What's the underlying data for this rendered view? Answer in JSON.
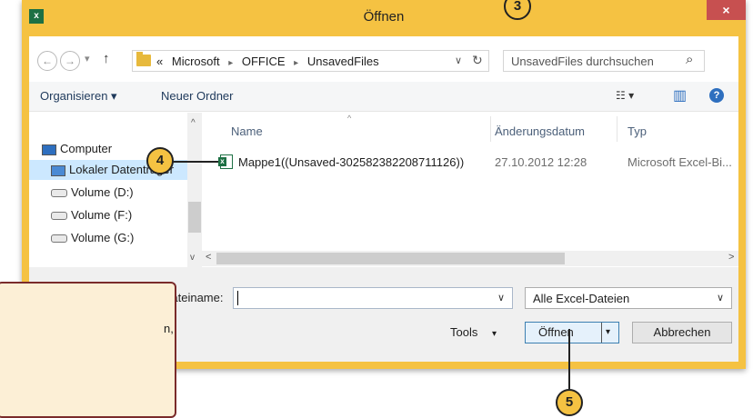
{
  "colors": {
    "frame": "#f5c242",
    "close_button": "#c75050",
    "excel_green": "#1d7044",
    "link_blue": "#1e395b",
    "selection": "#cce8ff",
    "callout_fill": "#f5c242",
    "note_fill": "#fcefd6",
    "note_border": "#7a2b2b"
  },
  "window": {
    "title": "Öffnen",
    "app_icon": "excel-icon",
    "close_glyph": "×"
  },
  "address_bar": {
    "back_glyph": "←",
    "forward_glyph": "→",
    "dropdown_glyph": "▾",
    "up_glyph": "↑",
    "overflow": "«",
    "crumbs": [
      "Microsoft",
      "OFFICE",
      "UnsavedFiles"
    ],
    "crumb_separator": "▸",
    "history_glyph": "∨",
    "refresh_glyph": "↻"
  },
  "search": {
    "placeholder": "UnsavedFiles durchsuchen",
    "icon_glyph": "⌕"
  },
  "toolbar": {
    "organize_label": "Organisieren ▾",
    "new_folder_label": "Neuer Ordner",
    "view_glyph": "☷ ▾",
    "preview_glyph": "▥",
    "help_glyph": "?"
  },
  "nav_pane": {
    "items": [
      {
        "label": "Computer",
        "icon": "computer-icon"
      },
      {
        "label": "Lokaler Datenträger",
        "icon": "drive-icon"
      },
      {
        "label": "Volume (D:)",
        "icon": "drive-icon"
      },
      {
        "label": "Volume (F:)",
        "icon": "drive-icon"
      },
      {
        "label": "Volume (G:)",
        "icon": "drive-icon"
      }
    ]
  },
  "file_list": {
    "columns": [
      "Name",
      "Änderungsdatum",
      "Typ"
    ],
    "sort_glyph": "^",
    "rows": [
      {
        "name": "Mappe1((Unsaved-302582382208711126))",
        "modified": "27.10.2012 12:28",
        "type": "Microsoft Excel-Bi..."
      }
    ]
  },
  "bottom": {
    "filename_label": "Dateiname:",
    "filename_value": "",
    "filetype_value": "Alle Excel-Dateien",
    "tools_label": "Tools",
    "open_label": "Öffnen",
    "cancel_label": "Abbrechen",
    "chevron": "∨",
    "tools_glyph": "▾",
    "open_split_glyph": "▾"
  },
  "callouts": {
    "three": "3",
    "four": "4",
    "five": "5"
  },
  "note_box": {
    "visible_text": "n,"
  }
}
